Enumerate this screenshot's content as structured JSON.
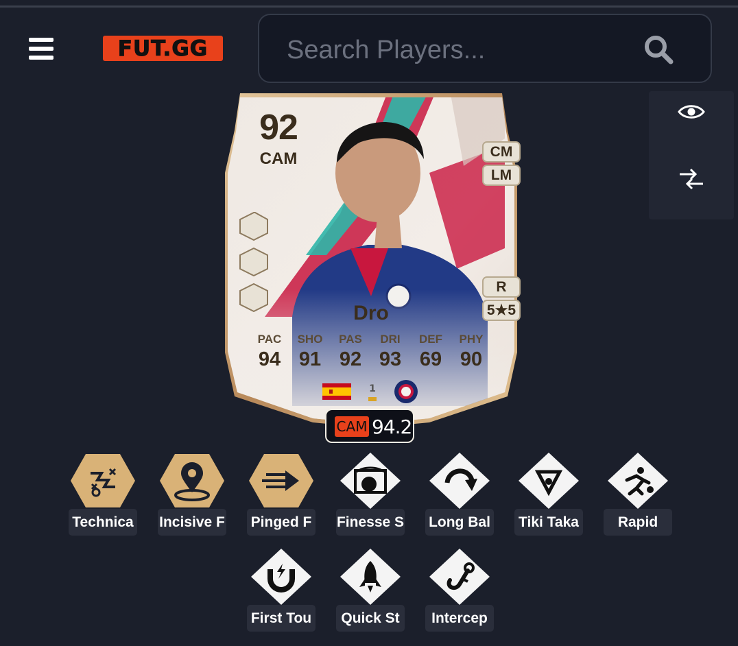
{
  "header": {
    "logo_text": "FUT.GG",
    "search_placeholder": "Search Players..."
  },
  "card": {
    "rating": "92",
    "position": "CAM",
    "alt_positions": [
      "CM",
      "LM"
    ],
    "preferred_foot": "R",
    "skill_weak": "5★5",
    "name": "Dro",
    "stats": [
      {
        "label": "PAC",
        "value": "94"
      },
      {
        "label": "SHO",
        "value": "91"
      },
      {
        "label": "PAS",
        "value": "92"
      },
      {
        "label": "DRI",
        "value": "93"
      },
      {
        "label": "DEF",
        "value": "69"
      },
      {
        "label": "PHY",
        "value": "90"
      }
    ],
    "nation": "Spain",
    "club": "Paris Saint-Germain",
    "accent_color": "#c8173e",
    "teal_color": "#2fb6a8"
  },
  "rating_badge": {
    "position": "CAM",
    "value": "94.2"
  },
  "playstyles": [
    {
      "label": "Technica",
      "plus": true,
      "icon": "technical-icon"
    },
    {
      "label": "Incisive F",
      "plus": true,
      "icon": "incisive-pass-icon"
    },
    {
      "label": "Pinged F",
      "plus": true,
      "icon": "pinged-pass-icon"
    },
    {
      "label": "Finesse S",
      "plus": false,
      "icon": "finesse-shot-icon"
    },
    {
      "label": "Long Bal",
      "plus": false,
      "icon": "long-ball-icon"
    },
    {
      "label": "Tiki Taka",
      "plus": false,
      "icon": "tiki-taka-icon"
    },
    {
      "label": "Rapid",
      "plus": false,
      "icon": "rapid-icon"
    },
    {
      "label": "First Tou",
      "plus": false,
      "icon": "first-touch-icon"
    },
    {
      "label": "Quick St",
      "plus": false,
      "icon": "quick-step-icon"
    },
    {
      "label": "Intercep",
      "plus": false,
      "icon": "intercept-icon"
    }
  ],
  "colors": {
    "background": "#1b1f2b",
    "brand": "#e8411b",
    "gold": "#d9b277"
  }
}
